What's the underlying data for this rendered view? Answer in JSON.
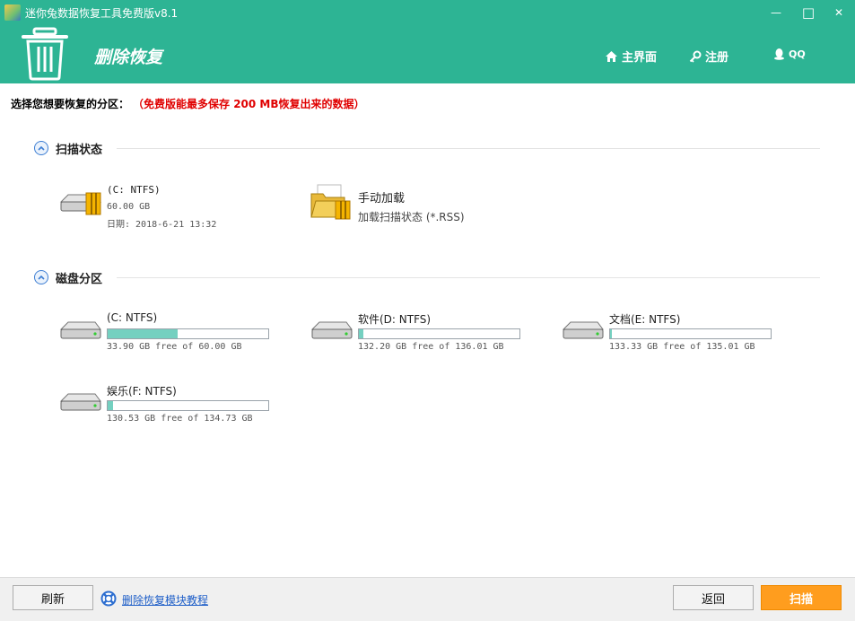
{
  "window": {
    "title": "迷你兔数据恢复工具免费版v8.1",
    "minimize_symbol": "—",
    "maximize_symbol": "□",
    "close_symbol": "✕"
  },
  "header": {
    "module_title": "删除恢复",
    "module_icon": "trash-icon",
    "nav": [
      {
        "label": "主界面",
        "icon": "home-icon"
      },
      {
        "label": "注册",
        "icon": "key-icon"
      },
      {
        "label": "QQ",
        "icon": "qq-penguin-icon"
      }
    ]
  },
  "prompt": {
    "label": "选择您想要恢复的分区：",
    "note": "（免费版能最多保存 200 MB恢复出来的数据）"
  },
  "scan_status": {
    "title": "扫描状态",
    "items": [
      {
        "name": "(C: NTFS)",
        "size": "60.00 GB",
        "date": "日期: 2018-6-21 13:32",
        "icon": "hard-drive-icon"
      },
      {
        "name": "手动加载",
        "desc": "加载扫描状态 (*.RSS)",
        "icon": "folder-icon"
      }
    ]
  },
  "partitions": {
    "title": "磁盘分区",
    "items": [
      {
        "name": "(C: NTFS)",
        "usage": "33.90 GB free of 60.00 GB",
        "fill": 0.435
      },
      {
        "name": "软件(D: NTFS)",
        "usage": "132.20 GB free of 136.01 GB",
        "fill": 0.028
      },
      {
        "name": "文档(E: NTFS)",
        "usage": "133.33 GB free of 135.01 GB",
        "fill": 0.012
      },
      {
        "name": "娱乐(F: NTFS)",
        "usage": "130.53 GB free of 134.73 GB",
        "fill": 0.031
      }
    ]
  },
  "footer": {
    "refresh": "刷新",
    "help_link": "删除恢复模块教程",
    "back": "返回",
    "scan": "扫描"
  },
  "colors": {
    "header_bg": "#2db494",
    "bar_fill": "#74d0c0",
    "scan_button": "#ff9d1e",
    "note_text": "#e00000"
  }
}
